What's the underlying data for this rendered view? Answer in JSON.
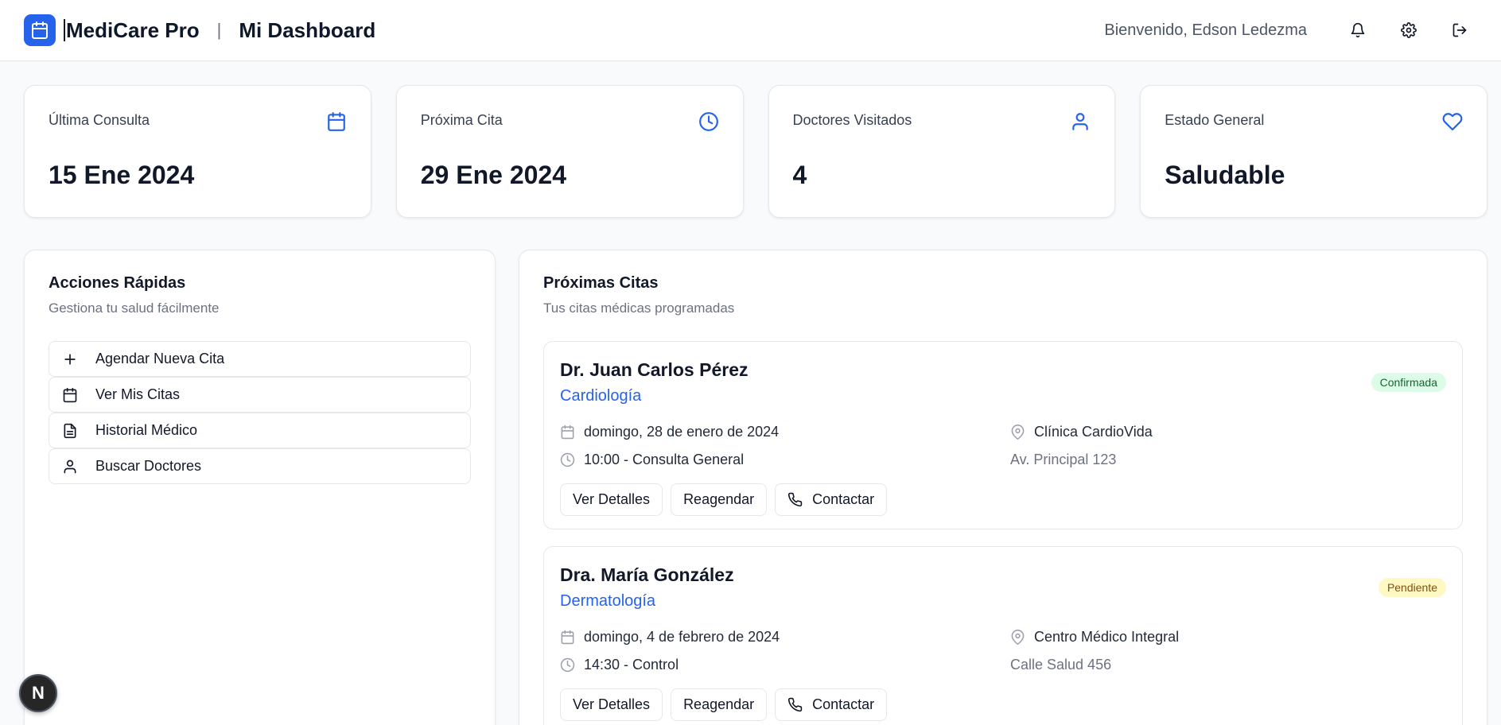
{
  "header": {
    "app_name": "MediCare Pro",
    "separator": "|",
    "page_title": "Mi Dashboard",
    "welcome": "Bienvenido, Edson Ledezma",
    "brand_color": "#2563eb"
  },
  "stats": [
    {
      "label": "Última Consulta",
      "value": "15 Ene 2024",
      "icon": "calendar-icon"
    },
    {
      "label": "Próxima Cita",
      "value": "29 Ene 2024",
      "icon": "clock-icon"
    },
    {
      "label": "Doctores Visitados",
      "value": "4",
      "icon": "user-icon"
    },
    {
      "label": "Estado General",
      "value": "Saludable",
      "icon": "heart-icon"
    }
  ],
  "quick_actions": {
    "title": "Acciones Rápidas",
    "subtitle": "Gestiona tu salud fácilmente",
    "items": [
      {
        "label": "Agendar Nueva Cita",
        "icon": "plus-icon"
      },
      {
        "label": "Ver Mis Citas",
        "icon": "calendar-icon"
      },
      {
        "label": "Historial Médico",
        "icon": "document-icon"
      },
      {
        "label": "Buscar Doctores",
        "icon": "user-icon"
      }
    ]
  },
  "appointments": {
    "title": "Próximas Citas",
    "subtitle": "Tus citas médicas programadas",
    "items": [
      {
        "doctor": "Dr. Juan Carlos Pérez",
        "specialty": "Cardiología",
        "status": "Confirmada",
        "status_color": "#dcfce7",
        "date": "domingo, 28 de enero de 2024",
        "time": "10:00 - Consulta General",
        "clinic": "Clínica CardioVida",
        "address": "Av. Principal 123"
      },
      {
        "doctor": "Dra. María González",
        "specialty": "Dermatología",
        "status": "Pendiente",
        "status_color": "#fef9c3",
        "date": "domingo, 4 de febrero de 2024",
        "time": "14:30 - Control",
        "clinic": "Centro Médico Integral",
        "address": "Calle Salud 456"
      }
    ],
    "buttons": {
      "details": "Ver Detalles",
      "reschedule": "Reagendar",
      "contact": "Contactar"
    }
  },
  "fab_label": "N"
}
